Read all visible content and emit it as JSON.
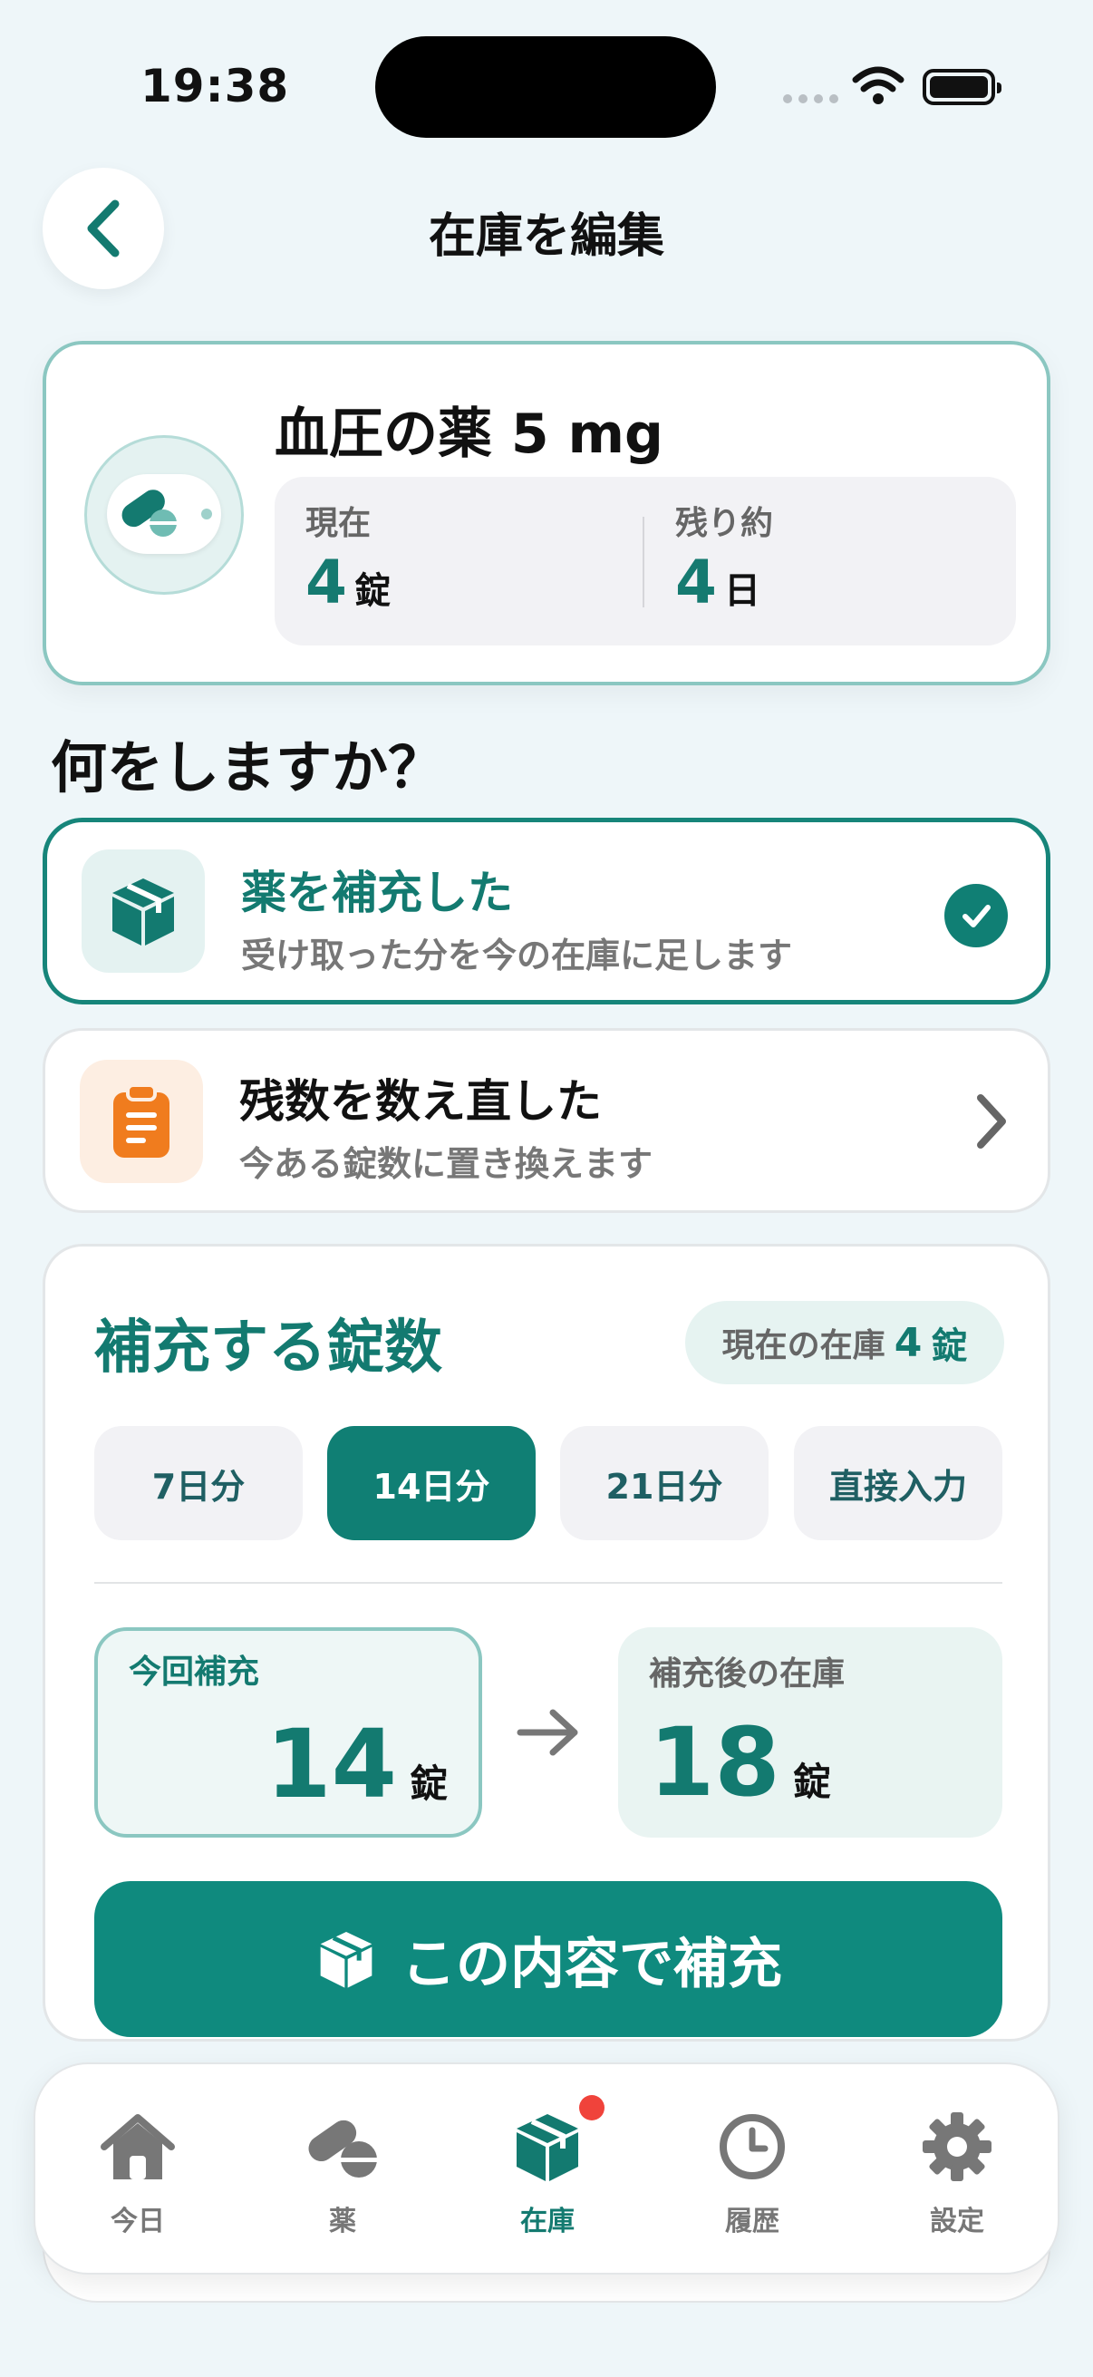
{
  "status_bar": {
    "time": "19:38"
  },
  "header": {
    "title": "在庫を編集",
    "back_icon": "chevron-left-icon"
  },
  "medication": {
    "name": "血圧の薬 5 mg",
    "current_label": "現在",
    "current_value": "4",
    "current_unit": "錠",
    "remaining_label": "残り約",
    "remaining_value": "4",
    "remaining_unit": "日"
  },
  "question": "何をしますか？",
  "options": [
    {
      "title": "薬を補充した",
      "subtitle": "受け取った分を今の在庫に足します",
      "selected": true,
      "icon": "box-icon"
    },
    {
      "title": "残数を数え直した",
      "subtitle": "今ある錠数に置き換えます",
      "selected": false,
      "icon": "clipboard-icon"
    }
  ],
  "refill": {
    "title": "補充する錠数",
    "stock_label": "現在の在庫",
    "stock_value": "4",
    "stock_unit": "錠",
    "presets": [
      {
        "label": "7日分",
        "active": false
      },
      {
        "label": "14日分",
        "active": true
      },
      {
        "label": "21日分",
        "active": false
      },
      {
        "label": "直接入力",
        "active": false
      }
    ],
    "now_label": "今回補充",
    "now_value": "14",
    "now_unit": "錠",
    "after_label": "補充後の在庫",
    "after_value": "18",
    "after_unit": "錠",
    "cta_label": "この内容で補充"
  },
  "tabs": [
    {
      "label": "今日",
      "icon": "home-icon",
      "active": false
    },
    {
      "label": "薬",
      "icon": "pill-icon",
      "active": false
    },
    {
      "label": "在庫",
      "icon": "box-icon",
      "active": true
    },
    {
      "label": "履歴",
      "icon": "clock-icon",
      "active": false
    },
    {
      "label": "設定",
      "icon": "gear-icon",
      "active": false
    }
  ],
  "colors": {
    "accent": "#107f74",
    "accent_text": "#137a70",
    "orange": "#f07c1e",
    "badge": "#f0433b"
  }
}
